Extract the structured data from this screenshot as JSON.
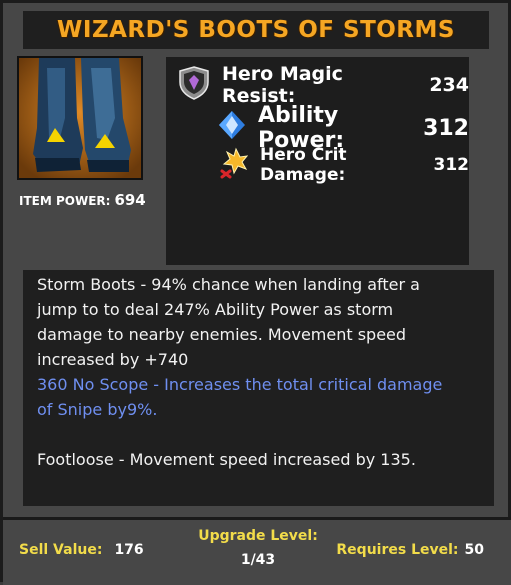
{
  "item": {
    "title": "WIZARD'S BOOTS OF STORMS",
    "icon": "storm-boots-icon",
    "power_label": "ITEM POWER:",
    "power_value": "694"
  },
  "stats": [
    {
      "icon": "shield-icon",
      "label": "Hero Magic Resist:",
      "value": "234"
    },
    {
      "icon": "diamond-icon",
      "label": "Ability Power:",
      "value": "312"
    },
    {
      "icon": "crit-burst-icon",
      "label": "Hero Crit Damage:",
      "value": "312"
    }
  ],
  "description": {
    "storm_boots_lines": [
      "Storm Boots - 94% chance when landing after a",
      "jump to to deal 247% Ability Power as storm",
      "damage to nearby enemies. Movement speed",
      "increased by +740"
    ],
    "no_scope_lines": [
      "360 No Scope - Increases the total critical damage",
      "of Snipe by9%."
    ],
    "footloose": "Footloose - Movement speed increased by 135."
  },
  "footer": {
    "sell_label": "Sell Value:",
    "sell_value": "176",
    "upgrade_label": "Upgrade Level:",
    "upgrade_value": "1/43",
    "requires_label": "Requires Level:",
    "requires_value": "50"
  },
  "colors": {
    "title": "#f5a623",
    "footer_label": "#f2dc4a",
    "ability_text": "#6f8ff0",
    "icon_bg": "#c87a1a"
  }
}
